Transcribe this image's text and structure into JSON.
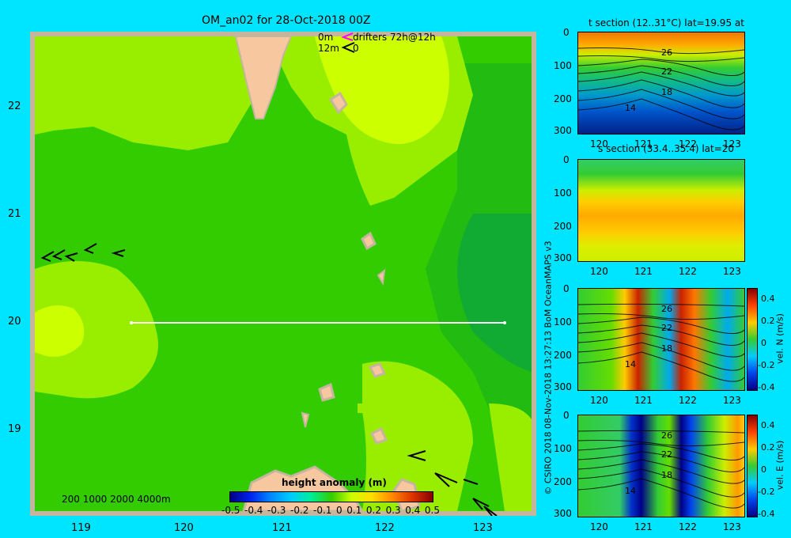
{
  "title": "OM_an02 for 28-Oct-2018 00Z",
  "legend": {
    "drifters_0m": "0m",
    "drifters_12m": "12m",
    "drifters_label": "drifters 72h@12h",
    "drifters_sub": "0",
    "bathy_contours": "200  1000  2000  4000m"
  },
  "colorbar": {
    "title": "height anomaly (m)",
    "ticks": [
      "-0.5",
      "-0.4",
      "-0.3",
      "-0.2",
      "-0.1",
      "0",
      "0.1",
      "0.2",
      "0.3",
      "0.4",
      "0.5"
    ]
  },
  "map": {
    "xticks": [
      "119",
      "120",
      "121",
      "122",
      "123"
    ],
    "yticks": [
      "22",
      "21",
      "20",
      "19"
    ],
    "section_line_lat": 20
  },
  "panels": {
    "t_section": {
      "title": "t section (12..31°C) lat=19.95 at",
      "yticks": [
        "0",
        "100",
        "200",
        "300"
      ],
      "xticks": [
        "120",
        "121",
        "122",
        "123"
      ],
      "contour_labels": [
        "26",
        "22",
        "18",
        "14"
      ]
    },
    "s_section": {
      "title": "s section (33.4..35.4) lat=20",
      "yticks": [
        "0",
        "100",
        "200",
        "300"
      ],
      "xticks": [
        "120",
        "121",
        "122",
        "123"
      ]
    },
    "vel_n": {
      "yticks": [
        "0",
        "100",
        "200",
        "300"
      ],
      "xticks": [
        "120",
        "121",
        "122",
        "123"
      ],
      "contour_labels": [
        "26",
        "22",
        "18",
        "14"
      ],
      "cbar_ticks": [
        "0.4",
        "0.2",
        "0",
        "-0.2",
        "-0.4"
      ],
      "cbar_label": "vel. N (m/s)"
    },
    "vel_e": {
      "yticks": [
        "0",
        "100",
        "200",
        "300"
      ],
      "xticks": [
        "120",
        "121",
        "122",
        "123"
      ],
      "contour_labels": [
        "26",
        "22",
        "18",
        "14"
      ],
      "cbar_ticks": [
        "0.4",
        "0.2",
        "0",
        "-0.2",
        "-0.4"
      ],
      "cbar_label": "vel. E (m/s)"
    }
  },
  "credit": "© CSIRO 2018  08-Nov-2018 13:27:13 BoM OceanMAPS v3",
  "colors": {
    "background": "#00e5ff",
    "land": "#f7c8a0",
    "main_green": "#33cc00",
    "light_green": "#99ee00",
    "yellow_green": "#ccff00"
  }
}
